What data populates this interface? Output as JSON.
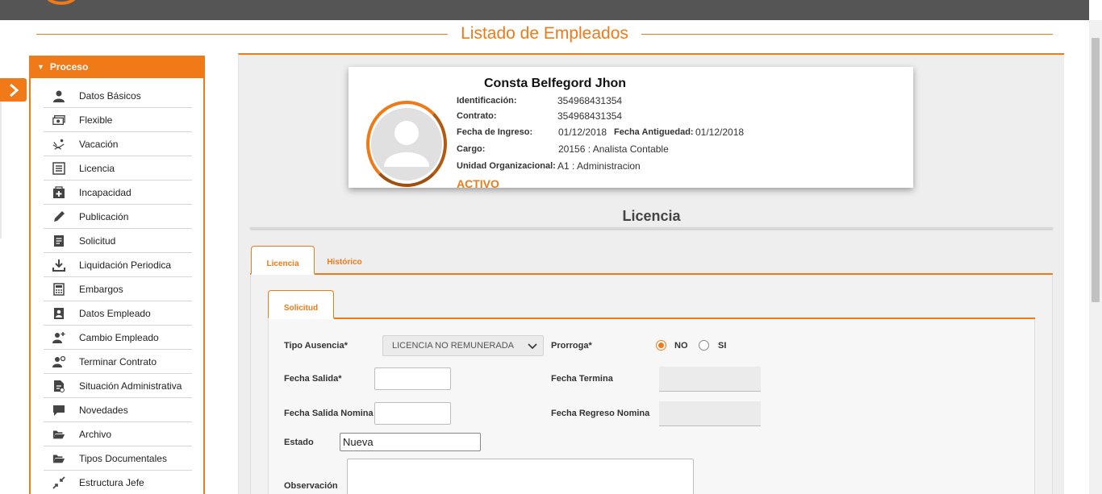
{
  "page_title": "Listado de Empleados",
  "sidebar": {
    "header": "Proceso",
    "items": [
      {
        "label": "Datos Básicos",
        "icon": "user-icon"
      },
      {
        "label": "Flexible",
        "icon": "money-icon"
      },
      {
        "label": "Vacación",
        "icon": "beach-chair-icon"
      },
      {
        "label": "Licencia",
        "icon": "list-doc-icon"
      },
      {
        "label": "Incapacidad",
        "icon": "medical-icon"
      },
      {
        "label": "Publicación",
        "icon": "pencil-icon"
      },
      {
        "label": "Solicitud",
        "icon": "form-icon"
      },
      {
        "label": "Liquidación Periodica",
        "icon": "download-icon"
      },
      {
        "label": "Embargos",
        "icon": "calculator-icon"
      },
      {
        "label": "Datos Empleado",
        "icon": "id-card-icon"
      },
      {
        "label": "Cambio Empleado",
        "icon": "user-change-icon"
      },
      {
        "label": "Terminar Contrato",
        "icon": "user-end-icon"
      },
      {
        "label": "Situación Administrativa",
        "icon": "doc-admin-icon"
      },
      {
        "label": "Novedades",
        "icon": "comment-icon"
      },
      {
        "label": "Archivo",
        "icon": "folder-open-icon"
      },
      {
        "label": "Tipos Documentales",
        "icon": "folder-docs-icon"
      },
      {
        "label": "Estructura Jefe",
        "icon": "compress-icon"
      }
    ]
  },
  "profile": {
    "name": "Consta Belfegord Jhon",
    "identificacion_label": "Identificación:",
    "identificacion": "354968431354",
    "contrato_label": "Contrato:",
    "contrato": "354968431354",
    "fecha_ingreso_label": "Fecha de Ingreso:",
    "fecha_ingreso": "01/12/2018",
    "fecha_antiguedad_label": "Fecha Antiguedad:",
    "fecha_antiguedad": "01/12/2018",
    "cargo_label": "Cargo:",
    "cargo": "20156 : Analista Contable",
    "unidad_label": "Unidad Organizacional:",
    "unidad": "A1 : Administracion",
    "status": "ACTIVO"
  },
  "section_title": "Licencia",
  "tabs": [
    {
      "label": "Licencia",
      "active": true
    },
    {
      "label": "Histórico",
      "active": false
    }
  ],
  "subtab": "Solicitud",
  "form": {
    "tipo_ausencia_label": "Tipo Ausencia*",
    "tipo_ausencia_value": "LICENCIA NO REMUNERADA",
    "prorroga_label": "Prorroga*",
    "prorroga_no": "NO",
    "prorroga_si": "SI",
    "prorroga_selected": "NO",
    "fecha_salida_label": "Fecha Salida*",
    "fecha_salida_value": "",
    "fecha_termina_label": "Fecha Termina",
    "fecha_salida_nomina_label": "Fecha Salida Nomina",
    "fecha_salida_nomina_value": "",
    "fecha_regreso_nomina_label": "Fecha Regreso Nomina",
    "estado_label": "Estado",
    "estado_value": "Nueva",
    "observacion_label": "Observación",
    "observacion_value": ""
  },
  "colors": {
    "accent": "#f07a18",
    "topbar": "#555555"
  }
}
